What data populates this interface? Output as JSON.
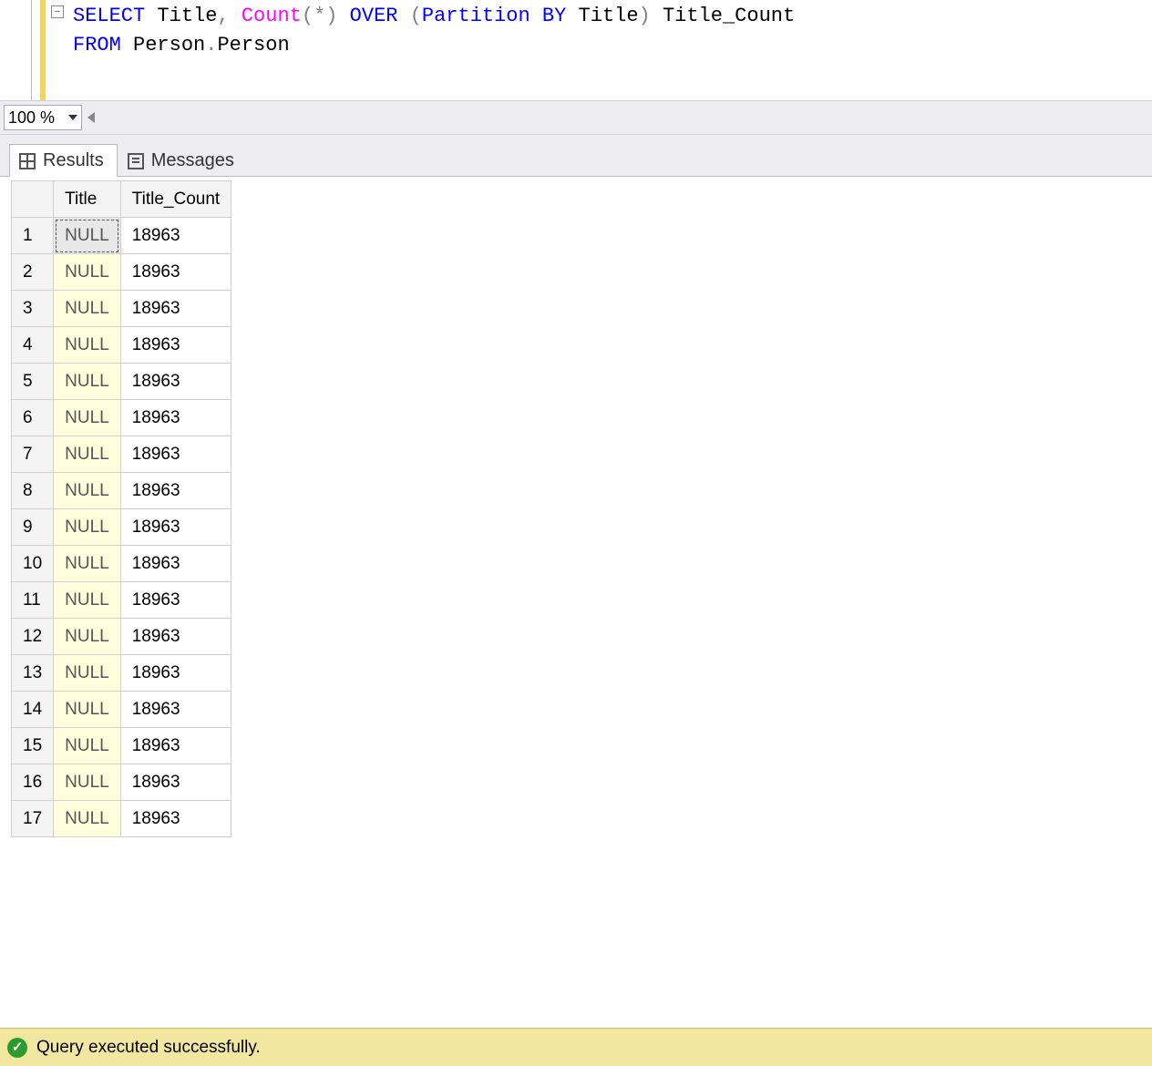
{
  "editor": {
    "line1": {
      "select": "SELECT",
      "title": " Title",
      "comma": ",",
      "count": " Count",
      "paren_open": "(",
      "star": "*",
      "paren_close": ")",
      "over": " OVER ",
      "paren_open2": "(",
      "partition": "Partition ",
      "by": "BY",
      "title2": " Title",
      "paren_close2": ")",
      "alias": " Title_Count"
    },
    "line2": {
      "from": "FROM",
      "table": " Person",
      "dot": ".",
      "table2": "Person"
    }
  },
  "zoom": {
    "value": "100 %"
  },
  "tabs": {
    "results": "Results",
    "messages": "Messages"
  },
  "grid": {
    "headers": {
      "col1": "Title",
      "col2": "Title_Count"
    },
    "null_label": "NULL",
    "rows": [
      {
        "n": "1",
        "c1": "NULL",
        "c2": "18963"
      },
      {
        "n": "2",
        "c1": "NULL",
        "c2": "18963"
      },
      {
        "n": "3",
        "c1": "NULL",
        "c2": "18963"
      },
      {
        "n": "4",
        "c1": "NULL",
        "c2": "18963"
      },
      {
        "n": "5",
        "c1": "NULL",
        "c2": "18963"
      },
      {
        "n": "6",
        "c1": "NULL",
        "c2": "18963"
      },
      {
        "n": "7",
        "c1": "NULL",
        "c2": "18963"
      },
      {
        "n": "8",
        "c1": "NULL",
        "c2": "18963"
      },
      {
        "n": "9",
        "c1": "NULL",
        "c2": "18963"
      },
      {
        "n": "10",
        "c1": "NULL",
        "c2": "18963"
      },
      {
        "n": "11",
        "c1": "NULL",
        "c2": "18963"
      },
      {
        "n": "12",
        "c1": "NULL",
        "c2": "18963"
      },
      {
        "n": "13",
        "c1": "NULL",
        "c2": "18963"
      },
      {
        "n": "14",
        "c1": "NULL",
        "c2": "18963"
      },
      {
        "n": "15",
        "c1": "NULL",
        "c2": "18963"
      },
      {
        "n": "16",
        "c1": "NULL",
        "c2": "18963"
      },
      {
        "n": "17",
        "c1": "NULL",
        "c2": "18963"
      }
    ]
  },
  "status": {
    "message": "Query executed successfully."
  }
}
